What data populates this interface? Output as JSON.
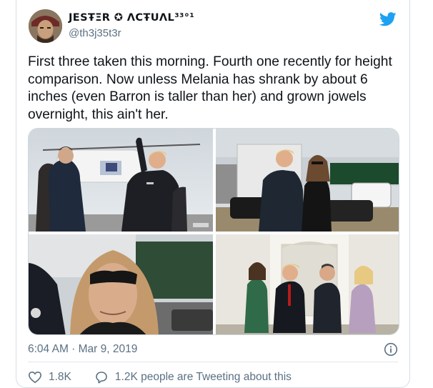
{
  "author": {
    "display_name": "JESŦΞR ✪ ΛCŦUΛL³³°¹",
    "handle": "@th3j35t3r"
  },
  "tweet": {
    "text": "First three taken this morning. Fourth one recently for height comparison. Now unless Melania has shrank by about 6 inches (even Barron is taller than her) and grown jowels overnight, this ain't her.",
    "timestamp": "6:04 AM · Mar 9, 2019",
    "like_count": "1.8K",
    "reply_text": "1.2K people are Tweeting about this"
  },
  "icons": [
    "avatar",
    "twitter-bird-icon",
    "info-icon",
    "heart-icon",
    "speech-bubble-icon"
  ],
  "colors": {
    "twitter_blue": "#1da1f2",
    "secondary_text": "#5b7083",
    "primary_text": "#0f1419",
    "border": "#d6dde3"
  }
}
